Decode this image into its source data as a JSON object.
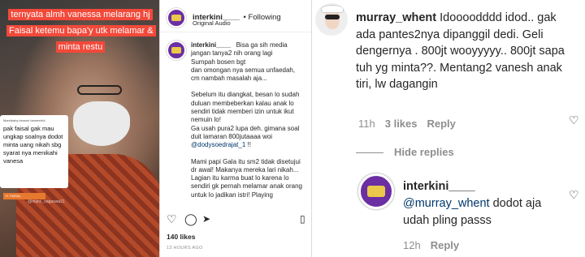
{
  "video": {
    "caption": "ternyata almh vanessa melarang hj Faisal ketemu bapa'y utk melamar & minta restu",
    "card_small": "Mamibaby kesemi tansemifol",
    "card_text": "pak faisal gak mau ungkap soalnya dodot minta uang nikah sbg syarat nya menikahi vanesa",
    "name_tag": "H. FAISAL",
    "watermark": "@mami_nagaswa21"
  },
  "post": {
    "username": "interkini____",
    "following": "• Following",
    "audio": "Original Audio",
    "caption_user": "interkini____",
    "caption_p1": "Bisa ga sih media jangan tanya2 nih orang lagi\nSumpah bosen bgt\ndan omongan nya semua unfaedah, cm nambah masalah aja...",
    "caption_p2": "Sebelum itu diangkat, besan lo sudah duluan membeberkan kalau anak lo sendiri tidak memberi izin untuk ikut nemuin lo!\nGa usah pura2 lupa deh. gimana soal duit lamaran 800jutaaaa woi",
    "caption_mention": "@dodysoedrajat_1",
    "caption_excl": " !!",
    "caption_p3": "Mami papi Gala itu sm2 tidak disetujui dr awal! Makanya mereka lari nikah...\nLagian itu karma buat lo karena lo sendiri gk pernah melamar anak orang untuk lo jadikan istri! Playing",
    "likes": "140 likes",
    "time": "13 HOURS AGO"
  },
  "comment": {
    "username": "murray_whent",
    "text": "Idoooodddd idod.. gak ada pantes2nya dipanggil dedi. Geli dengernya ​. 800jt wooyyyyy.. 800jt sapa tuh yg minta??. Mentang2 vanesh anak tiri, lw dagangin",
    "time": "11h",
    "likes": "3 likes",
    "reply": "Reply",
    "hide_replies": "Hide replies"
  },
  "reply": {
    "username": "interkini____",
    "mention": "@murray_whent",
    "text": " dodot aja udah pling passs",
    "time": "12h",
    "reply": "Reply"
  }
}
